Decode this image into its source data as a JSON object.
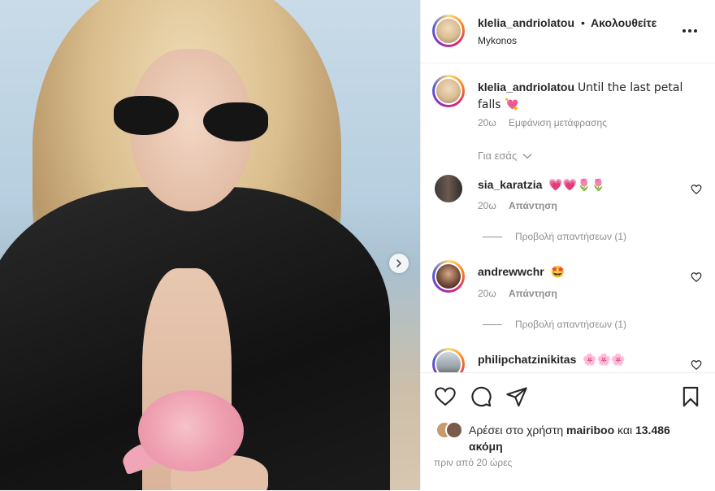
{
  "header": {
    "username": "klelia_andriolatou",
    "separator": "•",
    "follow_status": "Ακολουθείτε",
    "location": "Mykonos",
    "more_icon": "more-horizontal-icon"
  },
  "caption": {
    "username": "klelia_andriolatou",
    "text": "Until the last petal falls 💘",
    "time": "20ω",
    "translate": "Εμφάνιση μετάφρασης"
  },
  "for_you": "Για εσάς",
  "comments": [
    {
      "username": "sia_karatzia",
      "text": "💗💗🌷🌷",
      "time": "20ω",
      "reply": "Απάντηση",
      "view_replies": "Προβολή απαντήσεων (1)"
    },
    {
      "username": "andrewwchr",
      "text": "🤩",
      "time": "20ω",
      "reply": "Απάντηση",
      "view_replies": "Προβολή απαντήσεων (1)"
    },
    {
      "username": "philipchatzinikitas",
      "text": "🌸🌸🌸"
    }
  ],
  "likes": {
    "prefix": "Αρέσει στο χρήστη",
    "user": "mairiboo",
    "middle": "και",
    "count": "13.486",
    "suffix": "ακόμη"
  },
  "posted_ago": "πριν από 20 ώρες",
  "colors": {
    "text": "#262626",
    "muted": "#8e8e8e",
    "border": "#efefef"
  }
}
